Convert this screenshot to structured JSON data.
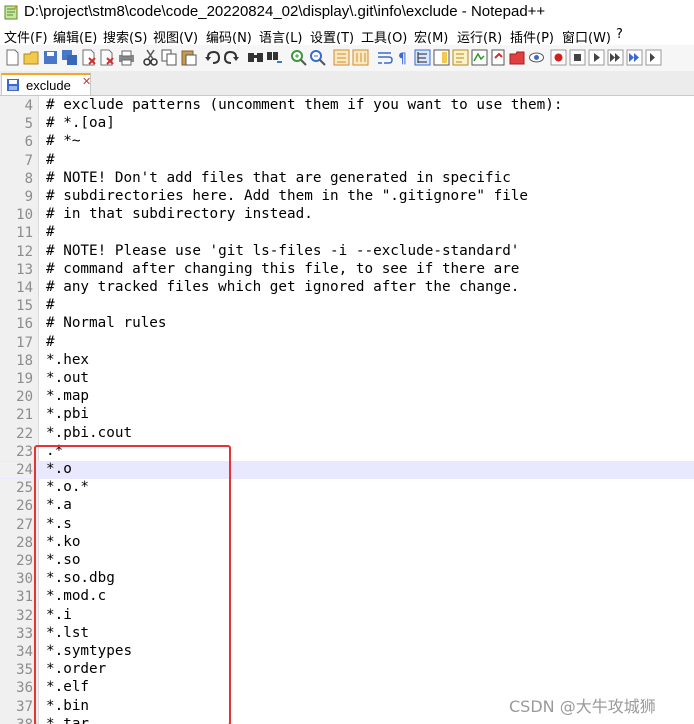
{
  "window": {
    "title": "D:\\project\\stm8\\code\\code_20220824_02\\display\\.git\\info\\exclude - Notepad++"
  },
  "menu": [
    "文件(F)",
    "编辑(E)",
    "搜索(S)",
    "视图(V)",
    "编码(N)",
    "语言(L)",
    "设置(T)",
    "工具(O)",
    "宏(M)",
    "运行(R)",
    "插件(P)",
    "窗口(W)",
    "?"
  ],
  "tab": {
    "label": "exclude",
    "close": "✕"
  },
  "editor": {
    "lines": [
      {
        "num": "4",
        "text": "# exclude patterns (uncomment them if you want to use them):"
      },
      {
        "num": "5",
        "text": "# *.[oa]"
      },
      {
        "num": "6",
        "text": "# *~"
      },
      {
        "num": "7",
        "text": "#"
      },
      {
        "num": "8",
        "text": "# NOTE! Don't add files that are generated in specific"
      },
      {
        "num": "9",
        "text": "# subdirectories here. Add them in the \".gitignore\" file"
      },
      {
        "num": "10",
        "text": "# in that subdirectory instead."
      },
      {
        "num": "11",
        "text": "#"
      },
      {
        "num": "12",
        "text": "# NOTE! Please use 'git ls-files -i --exclude-standard'"
      },
      {
        "num": "13",
        "text": "# command after changing this file, to see if there are"
      },
      {
        "num": "14",
        "text": "# any tracked files which get ignored after the change."
      },
      {
        "num": "15",
        "text": "#"
      },
      {
        "num": "16",
        "text": "# Normal rules"
      },
      {
        "num": "17",
        "text": "#"
      },
      {
        "num": "18",
        "text": "*.hex"
      },
      {
        "num": "19",
        "text": "*.out"
      },
      {
        "num": "20",
        "text": "*.map"
      },
      {
        "num": "21",
        "text": "*.pbi"
      },
      {
        "num": "22",
        "text": "*.pbi.cout"
      },
      {
        "num": "23",
        "text": ".*"
      },
      {
        "num": "24",
        "text": "*.o"
      },
      {
        "num": "25",
        "text": "*.o.*"
      },
      {
        "num": "26",
        "text": "*.a"
      },
      {
        "num": "27",
        "text": "*.s"
      },
      {
        "num": "28",
        "text": "*.ko"
      },
      {
        "num": "29",
        "text": "*.so"
      },
      {
        "num": "30",
        "text": "*.so.dbg"
      },
      {
        "num": "31",
        "text": "*.mod.c"
      },
      {
        "num": "32",
        "text": "*.i"
      },
      {
        "num": "33",
        "text": "*.lst"
      },
      {
        "num": "34",
        "text": "*.symtypes"
      },
      {
        "num": "35",
        "text": "*.order"
      },
      {
        "num": "36",
        "text": "*.elf"
      },
      {
        "num": "37",
        "text": "*.bin"
      },
      {
        "num": "38",
        "text": "*.tar"
      }
    ],
    "current_line": "24"
  },
  "watermark": "CSDN @大牛攻城狮",
  "colors": {
    "highlight_box": "#e53333",
    "current_line_bg": "#e8e8ff",
    "tab_accent": "#f5a623"
  }
}
